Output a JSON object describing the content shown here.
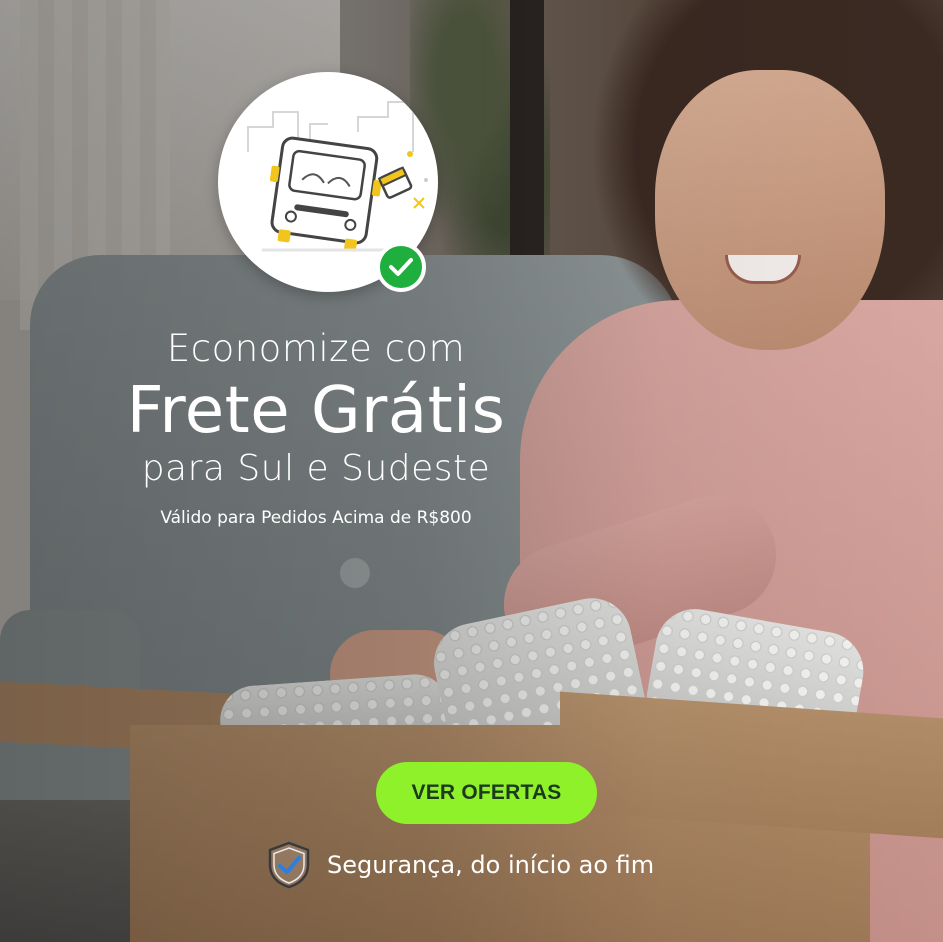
{
  "banner": {
    "headline_line1": "Economize com",
    "headline_line2": "Frete Grátis",
    "headline_line3": "para Sul e Sudeste",
    "condition": "Válido para Pedidos Acima de R$800",
    "cta_label": "VER OFERTAS",
    "security_text": "Segurança, do início ao fim"
  },
  "icons": {
    "illustration": "delivery-truck-illustration",
    "badge": "check-icon",
    "security": "shield-check-icon"
  },
  "colors": {
    "cta_background": "#8ef12a",
    "cta_text": "#1d3a1f",
    "badge_green": "#1faf3f",
    "headline_text": "#ffffff",
    "shield_check": "#2a7fe0",
    "illustration_accent": "#f2c51c"
  }
}
